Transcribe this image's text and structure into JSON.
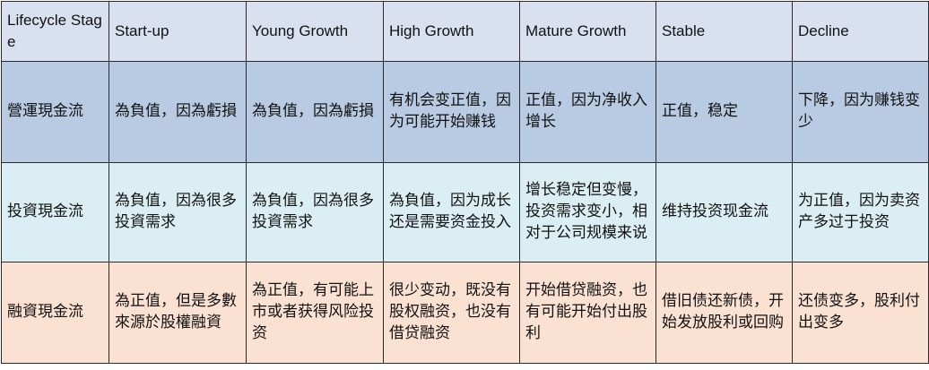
{
  "table": {
    "header": {
      "label": "Lifecycle Stage",
      "stages": [
        "Start-up",
        "Young Growth",
        "High Growth",
        "Mature Growth",
        "Stable",
        "Decline"
      ]
    },
    "rows": [
      {
        "label": "營運現金流",
        "cells": [
          "為負值，因為虧損",
          "為負值，因為虧損",
          "有机会变正值，因为可能开始赚钱",
          "正值，因为净收入增长",
          "正值，稳定",
          "下降，因为赚钱变少"
        ]
      },
      {
        "label": "投資現金流",
        "cells": [
          "為負值，因為很多投資需求",
          "為負值，因為很多投資需求",
          "為負值，因为成长还是需要资金投入",
          "增长稳定但变慢，投资需求变小，相对于公司规模来说",
          "维持投资现金流",
          "为正值，因为卖资产多过于投资"
        ]
      },
      {
        "label": "融資現金流",
        "cells": [
          "為正值，但是多數來源於股權融資",
          "為正值，有可能上市或者获得风险投资",
          "很少变动，既没有股权融资，也没有借贷融资",
          "开始借贷融资，也有可能开始付出股利",
          "借旧债还新债，开始发放股利或回购",
          "还债变多，股利付出变多"
        ]
      }
    ]
  }
}
